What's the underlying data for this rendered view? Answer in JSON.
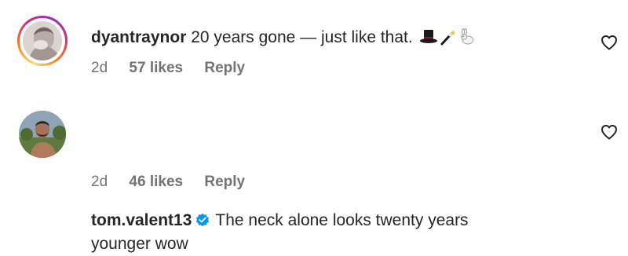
{
  "comments": [
    {
      "username": "dyantraynor",
      "verified": false,
      "text": "20 years gone — just like that.",
      "emojis": [
        "top-hat",
        "magic-wand",
        "rabbit"
      ],
      "time": "2d",
      "likes": "57 likes",
      "reply_label": "Reply",
      "avatar_has_story_ring": true
    },
    {
      "username": "tom.valent13",
      "verified": true,
      "text_line1": "The neck alone looks twenty years",
      "text_line2": "younger wow",
      "time": "2d",
      "likes": "46 likes",
      "reply_label": "Reply",
      "avatar_has_story_ring": false
    }
  ],
  "colors": {
    "text": "#262626",
    "secondary": "#737373",
    "verified_blue": "#0095f6"
  }
}
